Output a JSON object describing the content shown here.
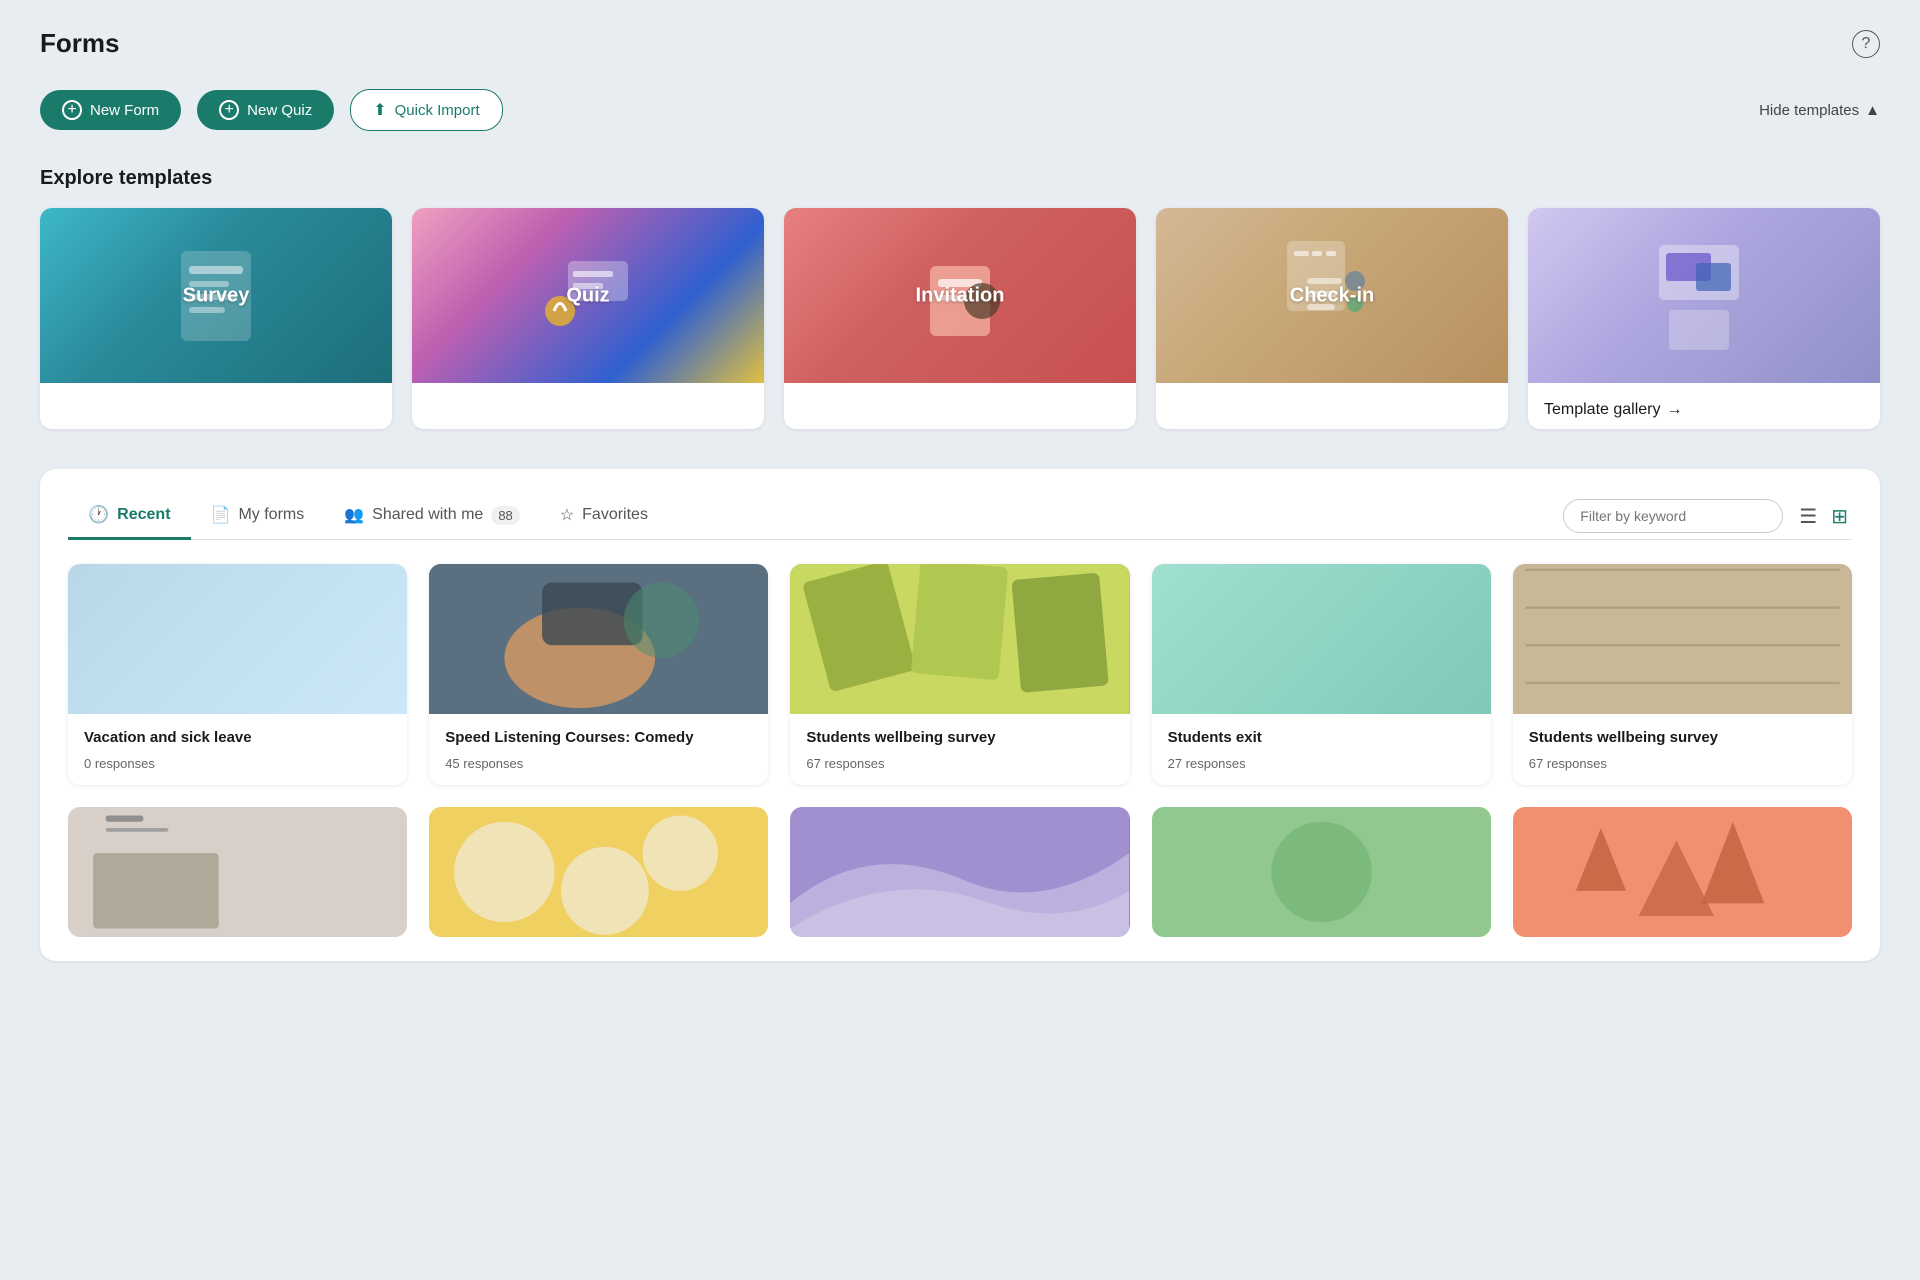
{
  "app": {
    "title": "Forms"
  },
  "header": {
    "help_label": "?"
  },
  "actions": {
    "new_form": "New Form",
    "new_quiz": "New Quiz",
    "quick_import": "Quick Import",
    "hide_templates": "Hide templates"
  },
  "templates_section": {
    "title": "Explore templates",
    "cards": [
      {
        "id": "survey",
        "label": "Survey",
        "color_class": "tmpl-survey"
      },
      {
        "id": "quiz",
        "label": "Quiz",
        "color_class": "tmpl-quiz"
      },
      {
        "id": "invitation",
        "label": "Invitation",
        "color_class": "tmpl-invitation"
      },
      {
        "id": "checkin",
        "label": "Check-in",
        "color_class": "tmpl-checkin"
      }
    ],
    "gallery_label": "Template gallery",
    "gallery_arrow": "→"
  },
  "tabs": {
    "items": [
      {
        "id": "recent",
        "label": "Recent",
        "active": true,
        "count": null
      },
      {
        "id": "myforms",
        "label": "My forms",
        "active": false,
        "count": null
      },
      {
        "id": "shared",
        "label": "Shared with me",
        "active": false,
        "count": "88"
      },
      {
        "id": "favorites",
        "label": "Favorites",
        "active": false,
        "count": null
      }
    ],
    "filter_placeholder": "Filter by keyword"
  },
  "form_cards": [
    {
      "title": "Vacation and sick leave",
      "responses": "0 responses",
      "color_class": "fc-lightblue"
    },
    {
      "title": "Speed Listening Courses: Comedy",
      "responses": "45 responses",
      "color_class": "fc-darkphoto"
    },
    {
      "title": "Students wellbeing survey",
      "responses": "67 responses",
      "color_class": "fc-yellow"
    },
    {
      "title": "Students exit",
      "responses": "27 responses",
      "color_class": "fc-mint"
    },
    {
      "title": "Students wellbeing survey",
      "responses": "67 responses",
      "color_class": "fc-tan"
    }
  ],
  "form_cards_row2": [
    {
      "color_class": "fc-white-marble"
    },
    {
      "color_class": "fc-yellow2"
    },
    {
      "color_class": "fc-purple"
    },
    {
      "color_class": "fc-softgreen"
    },
    {
      "color_class": "fc-peach"
    }
  ]
}
